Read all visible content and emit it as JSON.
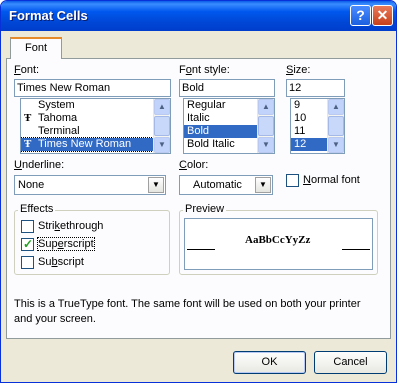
{
  "window": {
    "title": "Format Cells",
    "help_glyph": "?",
    "close_glyph": "✕"
  },
  "tabs": [
    {
      "label": "Font",
      "active": true
    }
  ],
  "font": {
    "label_prefix": "",
    "label_u": "F",
    "label_rest": "ont:",
    "value": "Times New Roman",
    "items": [
      {
        "label": "System",
        "truetype": false,
        "selected": false
      },
      {
        "label": "Tahoma",
        "truetype": true,
        "selected": false
      },
      {
        "label": "Terminal",
        "truetype": false,
        "selected": false
      },
      {
        "label": "Times New Roman",
        "truetype": true,
        "selected": true
      }
    ],
    "truetype_glyph": "Ŧ"
  },
  "font_style": {
    "label_prefo": "F",
    "label_prefix": "F",
    "label_mid_u": "o",
    "label_rest": "nt style:",
    "value": "Bold",
    "items": [
      {
        "label": "Regular",
        "selected": false
      },
      {
        "label": "Italic",
        "selected": false
      },
      {
        "label": "Bold",
        "selected": true
      },
      {
        "label": "Bold Italic",
        "selected": false
      }
    ]
  },
  "size": {
    "label_u": "S",
    "label_rest": "ize:",
    "value": "12",
    "items": [
      {
        "label": "9",
        "selected": false
      },
      {
        "label": "10",
        "selected": false
      },
      {
        "label": "11",
        "selected": false
      },
      {
        "label": "12",
        "selected": true
      }
    ]
  },
  "underline": {
    "label_u": "U",
    "label_rest": "nderline:",
    "value": "None"
  },
  "color": {
    "label_u": "C",
    "label_rest": "olor:",
    "value": "Automatic"
  },
  "normal_font": {
    "label_u": "N",
    "label_rest": "ormal font",
    "checked": false
  },
  "effects": {
    "title": "Effects",
    "strikethrough": {
      "before": "Stri",
      "u": "k",
      "after": "ethrough",
      "checked": false
    },
    "superscript": {
      "before": "Sup",
      "u": "e",
      "after": "rscript",
      "checked": true
    },
    "subscript": {
      "before": "Su",
      "u": "b",
      "after": "script",
      "checked": false
    },
    "check_glyph": "✓"
  },
  "preview": {
    "title": "Preview",
    "sample": "AaBbCcYyZz"
  },
  "info_text": "This is a TrueType font.  The same font will be used on both your printer and your screen.",
  "buttons": {
    "ok": "OK",
    "cancel": "Cancel"
  },
  "scroll": {
    "up_glyph": "▲",
    "down_glyph": "▼"
  },
  "combo_glyph": "▼",
  "colors": {
    "titlebar": "#0054e3",
    "selection": "#316ac5",
    "dialog_bg": "#ece9d8",
    "close_button": "#c7401a",
    "tab_highlight": "#e68b2c"
  }
}
